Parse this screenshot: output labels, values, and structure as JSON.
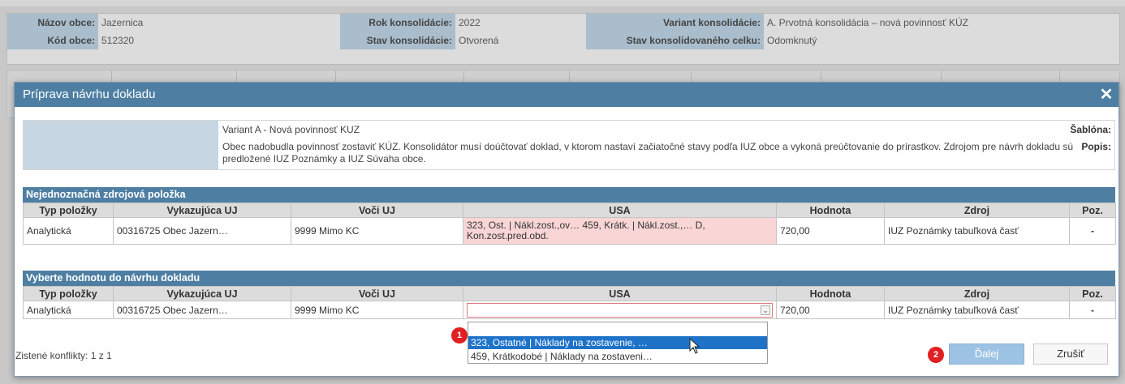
{
  "header": {
    "nazov_obce_label": "Názov obce:",
    "nazov_obce_value": "Jazernica",
    "kod_obce_label": "Kód obce:",
    "kod_obce_value": "512320",
    "rok_label": "Rok konsolidácie:",
    "rok_value": "2022",
    "stav_label": "Stav konsolidácie:",
    "stav_value": "Otvorená",
    "variant_label": "Variant konsolidácie:",
    "variant_value": "A. Prvotná konsolidácia – nová povinnosť KÚZ",
    "stav_celku_label": "Stav konsolidovaného celku:",
    "stav_celku_value": "Odomknutý"
  },
  "modal": {
    "title": "Príprava návrhu dokladu",
    "close_symbol": "✕",
    "sablona_label": "Šablóna:",
    "sablona_value": "Variant A - Nová povinnosť KUZ",
    "popis_label": "Popis:",
    "popis_value": "Obec nadobudla povinnosť zostaviť KÚZ. Konsolidátor musí doúčtovať doklad, v ktorom nastaví začiatočné stavy podľa IUZ obce a vykoná preúčtovanie do prírastkov. Zdrojom pre návrh dokladu sú predložené IUZ Poznámky a IUZ Súvaha obce."
  },
  "columns": [
    "Typ položky",
    "Vykazujúca UJ",
    "Voči UJ",
    "USA",
    "Hodnota",
    "Zdroj",
    "Poz."
  ],
  "section1": {
    "title": "Nejednoznačná zdrojová položka",
    "row": {
      "typ": "Analytická",
      "vykazujuca": "00316725 Obec Jazern…",
      "voci": "9999 Mimo KC",
      "usa": "323, Ost. | Nákl.zost.,ov… 459, Krátk. | Nákl.zost.,… D, Kon.zost.pred.obd.",
      "hodnota": "720,00",
      "zdroj": "IUZ Poznámky tabuľková časť",
      "poz": "-"
    }
  },
  "section2": {
    "title": "Vyberte hodnotu do návrhu dokladu",
    "row": {
      "typ": "Analytická",
      "vykazujuca": "00316725 Obec Jazern…",
      "voci": "9999 Mimo KC",
      "usa": "",
      "hodnota": "720,00",
      "zdroj": "IUZ Poznámky tabuľková časť",
      "poz": "-"
    }
  },
  "dropdown": {
    "options": [
      "323, Ostatné | Náklady na zostavenie, …",
      "459, Krátkodobé | Náklady na zostaveni…"
    ]
  },
  "badges": {
    "one": "1",
    "two": "2"
  },
  "footer": {
    "conflicts": "Zistené konflikty: 1 z 1",
    "next_label": "Ďalej",
    "cancel_label": "Zrušiť"
  },
  "colors": {
    "header_blue": "#4e7fa3",
    "label_blue": "#c6d6e2",
    "conflict_pink": "#f9d5d5",
    "selected_blue": "#1e73c8",
    "badge_red": "#e02020"
  }
}
